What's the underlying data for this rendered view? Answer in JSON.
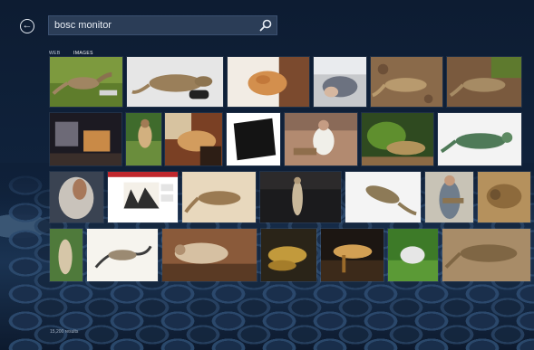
{
  "search": {
    "query": "bosc monitor"
  },
  "tabs": [
    {
      "label": "WEB",
      "active": false
    },
    {
      "label": "IMAGES",
      "active": true
    }
  ],
  "status": {
    "result_count": "15,200 results"
  },
  "icons": {
    "back": "back-arrow-icon",
    "search": "search-icon"
  },
  "thumbnails": [
    {
      "row": 1,
      "subject": "monitor lizard on grass"
    },
    {
      "row": 1,
      "subject": "monitor lizard on white"
    },
    {
      "row": 1,
      "subject": "monitor lizard close-up"
    },
    {
      "row": 1,
      "subject": "monitor lizard held"
    },
    {
      "row": 1,
      "subject": "monitor lizard on ground"
    },
    {
      "row": 1,
      "subject": "monitor lizard on mulch"
    },
    {
      "row": 2,
      "subject": "room interior"
    },
    {
      "row": 2,
      "subject": "person with lizard outdoors"
    },
    {
      "row": 2,
      "subject": "lizard in enclosure"
    },
    {
      "row": 2,
      "subject": "black frame"
    },
    {
      "row": 2,
      "subject": "person seated with lizard"
    },
    {
      "row": 2,
      "subject": "lizard on plants"
    },
    {
      "row": 2,
      "subject": "lizard on white background"
    },
    {
      "row": 3,
      "subject": "person holding lizard"
    },
    {
      "row": 3,
      "subject": "website screenshot"
    },
    {
      "row": 3,
      "subject": "lizard on sand"
    },
    {
      "row": 3,
      "subject": "lizard standing upright"
    },
    {
      "row": 3,
      "subject": "lizard on white floor"
    },
    {
      "row": 3,
      "subject": "man with lizard"
    },
    {
      "row": 3,
      "subject": "lizard close-up"
    },
    {
      "row": 4,
      "subject": "lizard climbing"
    },
    {
      "row": 4,
      "subject": "lizard sketch"
    },
    {
      "row": 4,
      "subject": "lizard close-up"
    },
    {
      "row": 4,
      "subject": "two lizards yellow"
    },
    {
      "row": 4,
      "subject": "lizard on table"
    },
    {
      "row": 4,
      "subject": "white lizard on grass"
    },
    {
      "row": 4,
      "subject": "lizard on gravel"
    }
  ]
}
